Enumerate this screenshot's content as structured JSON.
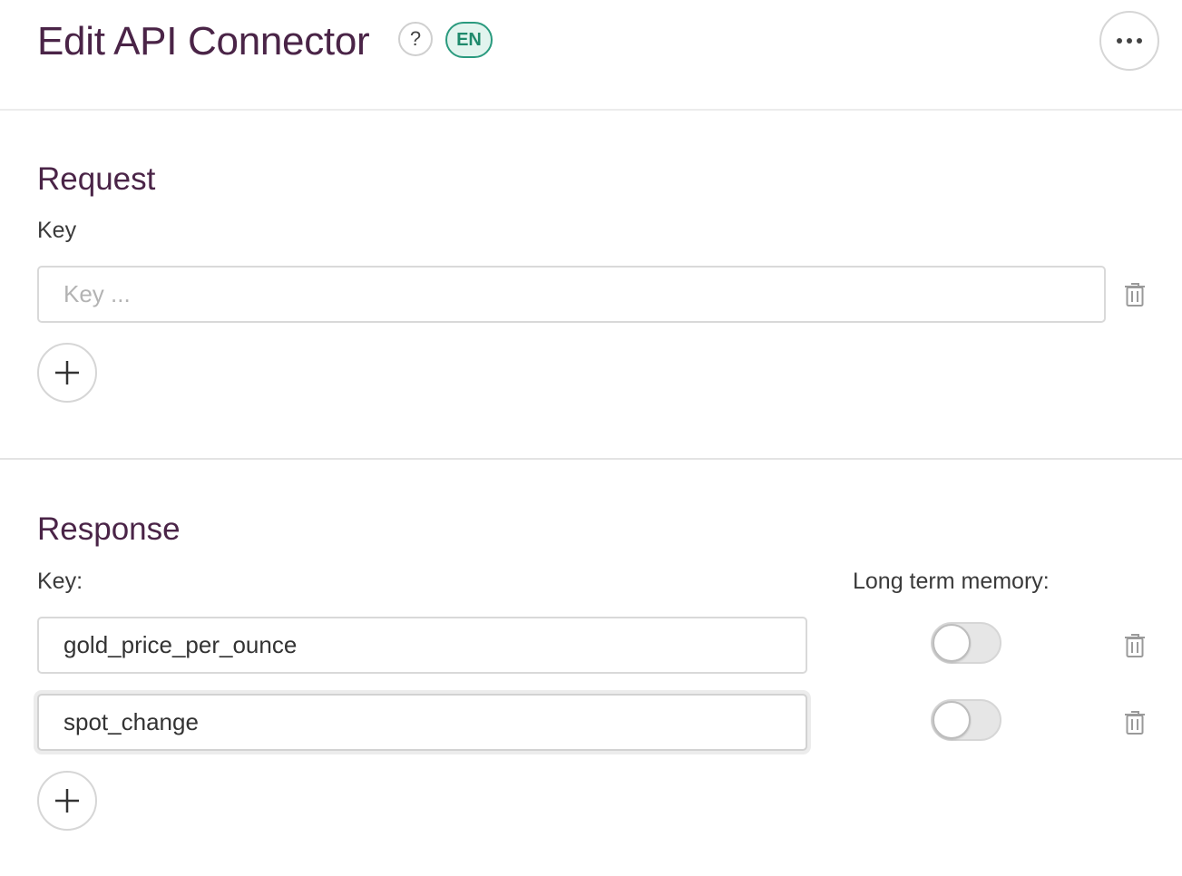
{
  "header": {
    "title": "Edit API Connector",
    "help_label": "?",
    "language_badge": "EN",
    "more_icon": "more-horizontal-icon"
  },
  "request": {
    "section_title": "Request",
    "key_label": "Key",
    "rows": [
      {
        "value": "",
        "placeholder": "Key ..."
      }
    ],
    "add_icon": "plus-icon",
    "delete_icon": "trash-icon"
  },
  "response": {
    "section_title": "Response",
    "key_label": "Key:",
    "memory_label": "Long term memory:",
    "rows": [
      {
        "value": "gold_price_per_ounce",
        "long_term_memory": false
      },
      {
        "value": "spot_change",
        "long_term_memory": false
      }
    ],
    "add_icon": "plus-icon",
    "delete_icon": "trash-icon"
  },
  "colors": {
    "title": "#4a2447",
    "badge_border": "#2a9a7e",
    "badge_bg": "#e2f4ee"
  }
}
